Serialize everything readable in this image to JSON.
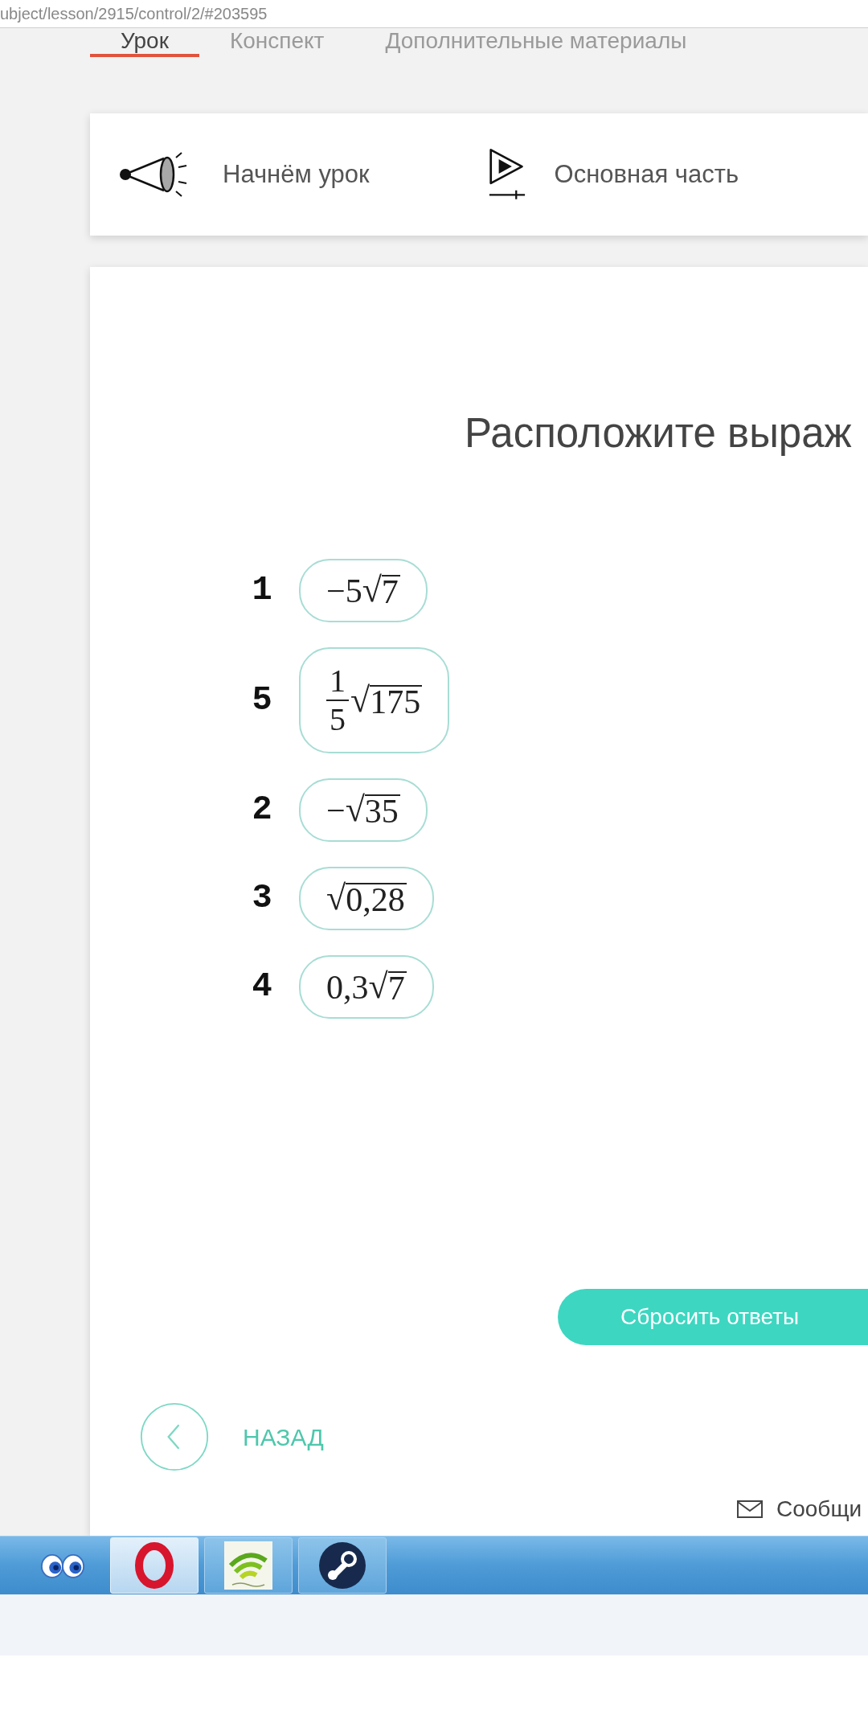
{
  "address_bar": {
    "url": "ubject/lesson/2915/control/2/#203595"
  },
  "tabs": [
    {
      "label": "Урок",
      "selected": true
    },
    {
      "label": "Конспект",
      "selected": false
    },
    {
      "label": "Дополнительные материалы",
      "selected": false
    }
  ],
  "lesson_steps": [
    {
      "kind": "megaphone",
      "label": "Начнём урок"
    },
    {
      "kind": "play",
      "label": "Основная часть"
    }
  ],
  "task": {
    "title": "Расположите выраж",
    "items": [
      {
        "number": "1",
        "expression": [
          {
            "kind": "text",
            "text": "−5"
          },
          {
            "kind": "sqrt",
            "sign": "√",
            "radicand": "7"
          }
        ]
      },
      {
        "number": "5",
        "expression": [
          {
            "kind": "fraction",
            "numerator": "1",
            "denominator": "5"
          },
          {
            "kind": "sqrt",
            "sign": "√",
            "radicand": "175"
          }
        ]
      },
      {
        "number": "2",
        "expression": [
          {
            "kind": "text",
            "text": "−"
          },
          {
            "kind": "sqrt",
            "sign": "√",
            "radicand": "35"
          }
        ]
      },
      {
        "number": "3",
        "expression": [
          {
            "kind": "sqrt",
            "sign": "√",
            "radicand": "0,28"
          }
        ]
      },
      {
        "number": "4",
        "expression": [
          {
            "kind": "text",
            "text": "0,3"
          },
          {
            "kind": "sqrt",
            "sign": "√",
            "radicand": "7"
          }
        ]
      }
    ]
  },
  "reset_button": {
    "label": "Сбросить ответы"
  },
  "back_link": {
    "label": "НАЗАД"
  },
  "report_link": {
    "label": "Сообщи"
  },
  "taskbar": {
    "pinned_icon": {
      "kind": "eyes"
    },
    "buttons": [
      {
        "kind": "ring",
        "selected": true
      },
      {
        "kind": "arcs",
        "selected": false
      },
      {
        "kind": "disc",
        "selected": false
      }
    ]
  }
}
